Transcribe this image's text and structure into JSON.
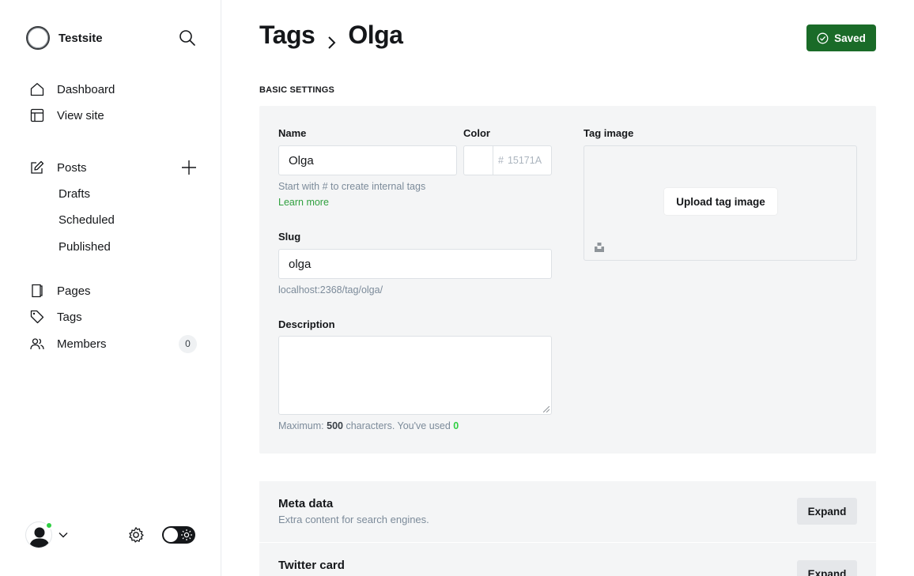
{
  "sidebar": {
    "site_name": "Testsite",
    "nav": [
      {
        "label": "Dashboard",
        "icon": "home-icon"
      },
      {
        "label": "View site",
        "icon": "layout-icon"
      },
      {
        "label": "Posts",
        "icon": "edit-icon"
      },
      {
        "label": "Pages",
        "icon": "page-icon"
      },
      {
        "label": "Tags",
        "icon": "tag-icon"
      },
      {
        "label": "Members",
        "icon": "members-icon"
      }
    ],
    "post_subitems": [
      "Drafts",
      "Scheduled",
      "Published"
    ],
    "members_count": "0",
    "status_color": "#30cf43"
  },
  "header": {
    "breadcrumb_root": "Tags",
    "breadcrumb_current": "Olga",
    "saved_label": "Saved",
    "saved_color": "#1a6b28"
  },
  "basic": {
    "section_title": "BASIC SETTINGS",
    "name_label": "Name",
    "name_value": "Olga",
    "color_label": "Color",
    "color_hash": "#",
    "color_placeholder": "15171A",
    "name_hint": "Start with # to create internal tags",
    "learn_more": "Learn more",
    "slug_label": "Slug",
    "slug_value": "olga",
    "slug_url": "localhost:2368/tag/olga/",
    "description_label": "Description",
    "desc_hint_prefix": "Maximum: ",
    "desc_max": "500",
    "desc_hint_mid": " characters. You've used ",
    "desc_used": "0",
    "tag_image_label": "Tag image",
    "upload_label": "Upload tag image"
  },
  "sections": [
    {
      "title": "Meta data",
      "subtitle": "Extra content for search engines.",
      "button": "Expand"
    },
    {
      "title": "Twitter card",
      "subtitle": "",
      "button": "Expand"
    }
  ]
}
